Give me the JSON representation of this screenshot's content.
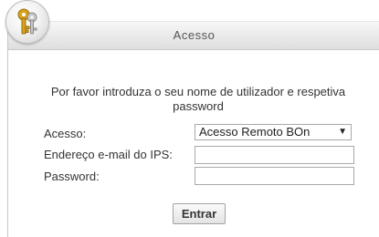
{
  "header": {
    "title": "Acesso",
    "logo_icon": "keys-icon"
  },
  "intro": {
    "text": "Por favor introduza o seu nome de utilizador e respetiva password"
  },
  "form": {
    "access_label": "Acesso:",
    "access_selected": "Acesso Remoto BOn",
    "access_caret": "▼",
    "email_label": "Endereço e-mail do IPS:",
    "email_value": "",
    "password_label": "Password:",
    "password_value": "",
    "submit_label": "Entrar"
  },
  "colors": {
    "header_gradient_top": "#f7f7f7",
    "header_gradient_bottom": "#dedede",
    "text": "#333333",
    "border": "#a9a9a9"
  }
}
